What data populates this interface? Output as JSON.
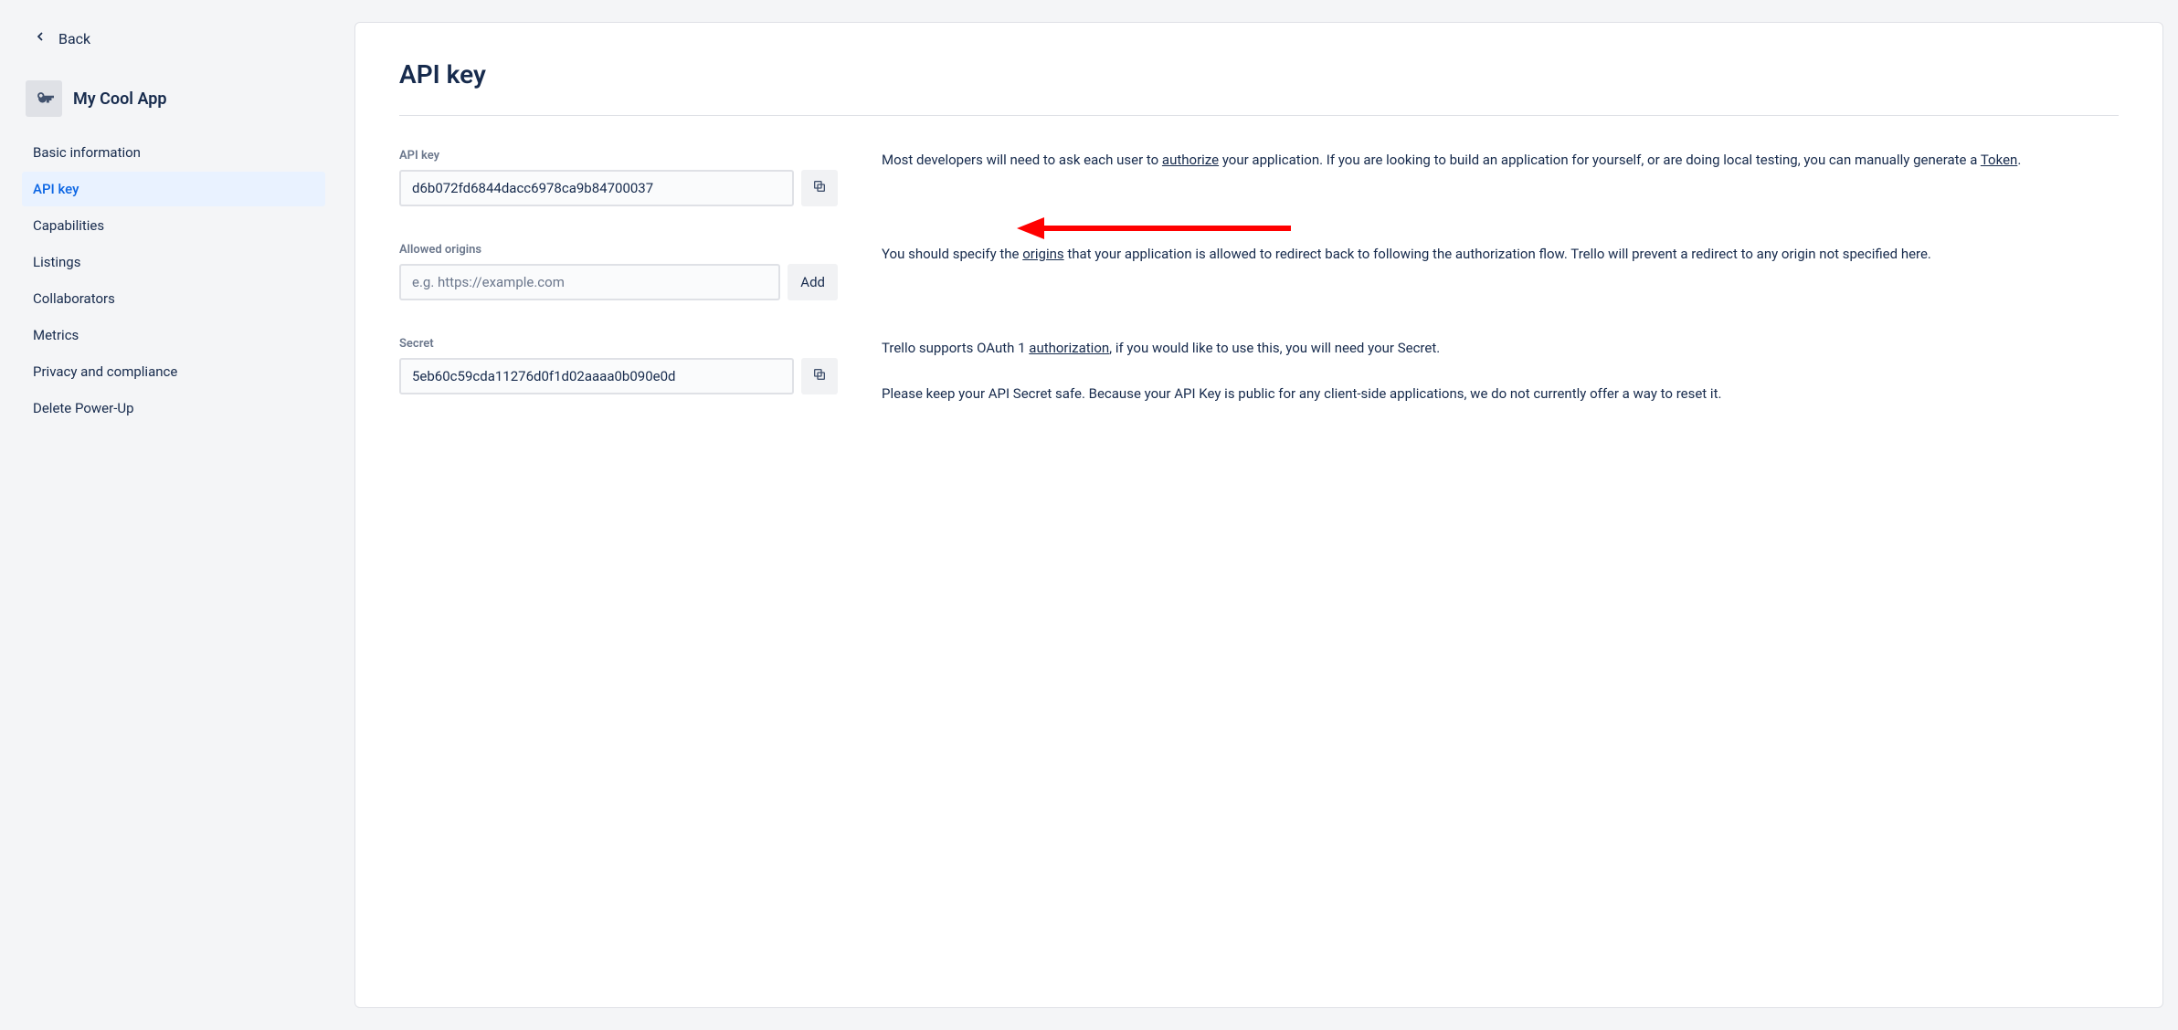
{
  "back_label": "Back",
  "app_name": "My Cool App",
  "nav": {
    "items": [
      {
        "label": "Basic information",
        "active": false
      },
      {
        "label": "API key",
        "active": true
      },
      {
        "label": "Capabilities",
        "active": false
      },
      {
        "label": "Listings",
        "active": false
      },
      {
        "label": "Collaborators",
        "active": false
      },
      {
        "label": "Metrics",
        "active": false
      },
      {
        "label": "Privacy and compliance",
        "active": false
      },
      {
        "label": "Delete Power-Up",
        "active": false
      }
    ]
  },
  "page_title": "API key",
  "api_key": {
    "label": "API key",
    "value": "d6b072fd6844dacc6978ca9b84700037",
    "help_pre": "Most developers will need to ask each user to ",
    "help_link1": "authorize",
    "help_mid": " your application. If you are looking to build an application for yourself, or are doing local testing, you can manually generate a ",
    "help_link2": "Token",
    "help_post": "."
  },
  "origins": {
    "label": "Allowed origins",
    "placeholder": "e.g. https://example.com",
    "add_label": "Add",
    "help_pre": "You should specify the ",
    "help_link": "origins",
    "help_post": " that your application is allowed to redirect back to following the authorization flow. Trello will prevent a redirect to any origin not specified here."
  },
  "secret": {
    "label": "Secret",
    "value": "5eb60c59cda11276d0f1d02aaaa0b090e0d",
    "help1_pre": "Trello supports OAuth 1 ",
    "help1_link": "authorization",
    "help1_post": ", if you would like to use this, you will need your Secret.",
    "help2": "Please keep your API Secret safe. Because your API Key is public for any client-side applications, we do not currently offer a way to reset it."
  }
}
